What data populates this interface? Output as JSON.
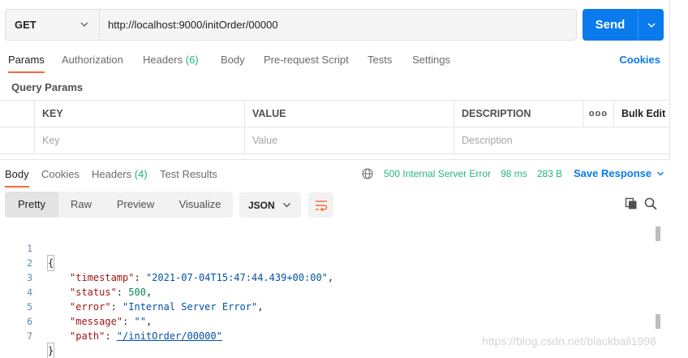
{
  "request": {
    "method": "GET",
    "url": "http://localhost:9000/initOrder/00000",
    "send_label": "Send"
  },
  "request_tabs": [
    {
      "label": "Params",
      "active": true
    },
    {
      "label": "Authorization"
    },
    {
      "label": "Headers",
      "count": "(6)"
    },
    {
      "label": "Body"
    },
    {
      "label": "Pre-request Script"
    },
    {
      "label": "Tests"
    },
    {
      "label": "Settings"
    }
  ],
  "cookies_label": "Cookies",
  "query_params": {
    "title": "Query Params",
    "headers": {
      "key": "KEY",
      "value": "VALUE",
      "description": "DESCRIPTION",
      "more": "ooo",
      "bulk_edit": "Bulk Edit"
    },
    "placeholders": {
      "key": "Key",
      "value": "Value",
      "description": "Description"
    }
  },
  "response_tabs": [
    {
      "label": "Body",
      "active": true
    },
    {
      "label": "Cookies"
    },
    {
      "label": "Headers",
      "count": "(4)"
    },
    {
      "label": "Test Results"
    }
  ],
  "response_status": {
    "status": "500 Internal Server Error",
    "time": "98 ms",
    "size": "283 B",
    "save_label": "Save Response"
  },
  "view_modes": [
    {
      "label": "Pretty",
      "active": true
    },
    {
      "label": "Raw"
    },
    {
      "label": "Preview"
    },
    {
      "label": "Visualize"
    }
  ],
  "format": "JSON",
  "body": {
    "line_numbers": [
      "1",
      "2",
      "3",
      "4",
      "5",
      "6",
      "7"
    ],
    "open_brace": "{",
    "close_brace": "}",
    "fields": [
      {
        "key": "\"timestamp\"",
        "value": "\"2021-07-04T15:47:44.439+00:00\"",
        "kind": "string"
      },
      {
        "key": "\"status\"",
        "value": "500",
        "kind": "number"
      },
      {
        "key": "\"error\"",
        "value": "\"Internal Server Error\"",
        "kind": "string"
      },
      {
        "key": "\"message\"",
        "value": "\"\"",
        "kind": "string"
      },
      {
        "key": "\"path\"",
        "value": "\"/initOrder/00000\"",
        "kind": "link"
      }
    ]
  },
  "watermark": "https://blog.csdn.net/blackball1998",
  "colors": {
    "accent": "#097bed",
    "tab_indicator": "#f26b3a",
    "status_green": "#26b47f"
  },
  "icons": {
    "method_dropdown": "chevron-down-icon",
    "send_dropdown": "chevron-down-icon",
    "network": "globe-icon",
    "wrap": "wrap-lines-icon",
    "copy": "copy-icon",
    "search": "search-icon"
  }
}
